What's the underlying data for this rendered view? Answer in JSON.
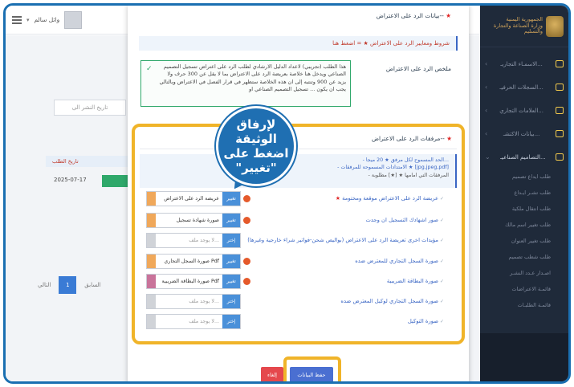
{
  "sidebar": {
    "logo": [
      "الجمهورية اليمنية",
      "وزارة الصناعة والتجارة",
      "والتسليم"
    ],
    "items": [
      {
        "label": "الاسمـاء التجاريـ..."
      },
      {
        "label": "السجلات الحرفيـ..."
      },
      {
        "label": "العلامات التجاري..."
      },
      {
        "label": "بيانات الاكتشـ..."
      },
      {
        "label": "التصاميم الصناعيـ..."
      }
    ],
    "sub_items": [
      "طلب ايداع تصميم",
      "طلب تشـر ايـداع",
      "طلب انتقال ملكية",
      "طلب تغيير اسم مالك",
      "طلب تغيير العنوان",
      "طلب شطب تصميم",
      "اصـدار عـدد النشـر",
      "قائمـة الاعتراضات",
      "قائمـة الطلبـات"
    ]
  },
  "topbar": {
    "user_name": "وائل سالم",
    "caret": "▾"
  },
  "background": {
    "date_placeholder": "تاريخ النشر الى",
    "table_header": "تاريخ الطلب",
    "table_cell": "2025-07-17",
    "pager_prev": "السابق",
    "pager_page": "1",
    "pager_next": "التالي"
  },
  "modal": {
    "title": "بيانات الرد على الاعتراض--",
    "terms_bar": "شروط ومعايير الرد على الاعتراض ★ = اضغط هنا",
    "summary_label": "ملخص الرد على الاعتراض",
    "summary_text": "هذا الطلب (تجريبي) لاعداد الدليل الارشادي لطلب الرد على اعتراض تسجيل التصميم الصناعي ويدخل هنا خلاصة بعريضة الرد على الاعتراض بما لا يقل عن 300 حرف ولا يزيد عن 900 وتنتبه إلى ان هذه الخلاصة ستظهر في قرار الفصل في الاعتراض وبالتالي يجب ان يكون ... تسجيل التصميم الصناعي او",
    "attachments": {
      "title": "مرفقات الرد على الاعتراض--",
      "info_line1": "- الحد المسموح لكل مرفق ★ 20 ميجا...",
      "info_line2": "- الامتدادات المسموحة للمرفقات ★ [jpg,jpeg,pdf]",
      "info_line3": "- المرفقات التي امامها ★ [★] مطلوبة",
      "rows": [
        {
          "label": "عريضة الرد على الاعتراض موقعة ومختومة",
          "required": "★",
          "button": "تغيير",
          "file": "عريضة الرد على الاعتراض",
          "swatch": "#f0a85a",
          "dot": true
        },
        {
          "label": "صور اشهادك التسجيل ان وجدت",
          "required": "",
          "button": "تغيير",
          "file": "صورة شهادة تسجيل",
          "swatch": "#f0a85a",
          "dot": true
        },
        {
          "label": "مؤيدات اخرى تعريضة الرد على الاعتراض (بواليص شحن-فواتير شراء خارجية وغيرها)",
          "required": "",
          "button": "إختر",
          "file": "لا يوجد ملف...",
          "swatch": "#d0d3d8",
          "dot": false
        },
        {
          "label": "صورة السجل التجاري للمعترض ضده",
          "required": "",
          "button": "تغيير",
          "file": "صورة السجل التجاري Pdf",
          "swatch": "#f0a85a",
          "dot": true
        },
        {
          "label": "صورة البطاقة الضريبية",
          "required": "",
          "button": "تغيير",
          "file": "صورة البطاقة الضريبية Pdf",
          "swatch": "#c9739a",
          "dot": true
        },
        {
          "label": "صورة السجل التجاري لوكيل المعترض ضده",
          "required": "",
          "button": "إختر",
          "file": "لا يوجد ملف...",
          "swatch": "#d0d3d8",
          "dot": false
        },
        {
          "label": "صورة التوكيل",
          "required": "",
          "button": "إختر",
          "file": "لا يوجد ملف...",
          "swatch": "#d0d3d8",
          "dot": false
        }
      ]
    },
    "save_button": "حفظ البيانات",
    "cancel_button": "إلغاء"
  },
  "callout": {
    "line1": "لإرفاق الوثيقة",
    "line2": "اضغط على",
    "line3": "\"تغيير\""
  }
}
